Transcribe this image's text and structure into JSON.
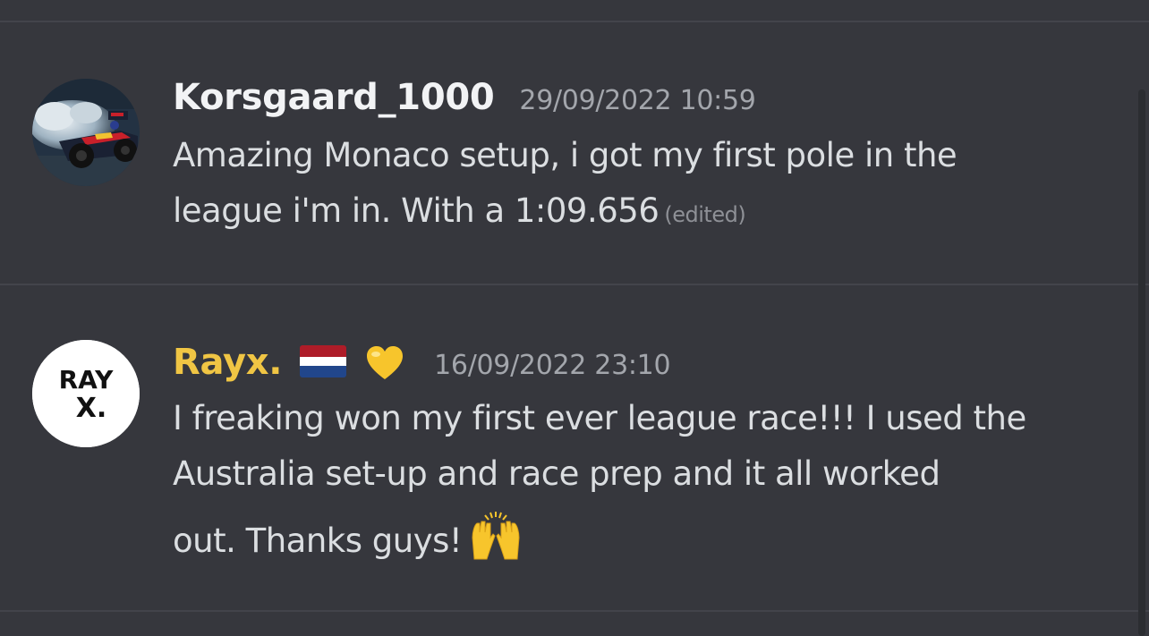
{
  "messages": [
    {
      "username": "Korsgaard_1000",
      "username_color": "#f2f3f5",
      "timestamp": "29/09/2022 10:59",
      "line1": "Amazing Monaco setup, i got my first pole in the",
      "line2": "league i'm in. With a 1:09.656",
      "edited": "(edited)",
      "avatar": "race-car-avatar"
    },
    {
      "username": "Rayx.",
      "username_color": "#f0c544",
      "timestamp": "16/09/2022 23:10",
      "badges": [
        "netherlands-flag-icon",
        "yellow-heart-icon"
      ],
      "line1": "I freaking won my first ever league race!!! I used the",
      "line2": "Australia set-up and race prep and it all worked",
      "line3": "out. Thanks guys!",
      "emoji": "raising-hands-icon",
      "avatar": "rayx-logo-avatar",
      "avatar_text_top": "RAY",
      "avatar_text_bottom": "X."
    }
  ]
}
